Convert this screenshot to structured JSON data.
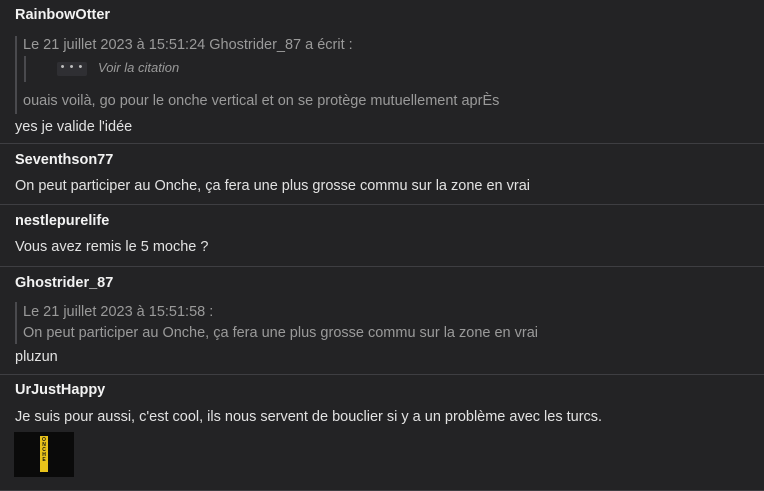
{
  "posts": [
    {
      "author": "RainbowOtter",
      "quote": {
        "header": "Le 21 juillet 2023 à 15:51:24 Ghostrider_87 a écrit :",
        "nested_button": "• • •",
        "nested_label": "Voir la citation",
        "body": "ouais voilà, go pour le onche vertical et on se protège mutuellement aprÈs"
      },
      "text": "yes je valide l'idée"
    },
    {
      "author": "Seventhson77",
      "text": "On peut participer au Onche, ça fera une plus grosse commu sur la zone en vrai"
    },
    {
      "author": "nestlepurelife",
      "text": "Vous avez remis le 5 moche ?"
    },
    {
      "author": "Ghostrider_87",
      "quote": {
        "header": "Le 21 juillet 2023 à 15:51:58 :",
        "body": "On peut participer au Onche, ça fera une plus grosse commu sur la zone en vrai"
      },
      "text": "pluzun"
    },
    {
      "author": "UrJustHappy",
      "text": "Je suis pour aussi, c'est cool, ils nous servent de bouclier si y a un problème avec les turcs.",
      "sticker_text": "ONCHE"
    }
  ]
}
